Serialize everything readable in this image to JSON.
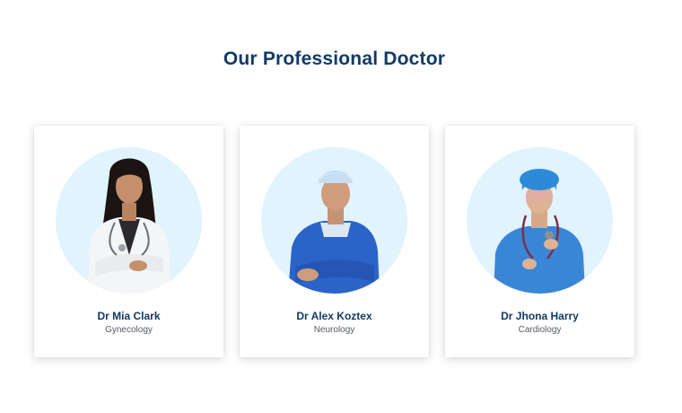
{
  "section": {
    "title": "Our Professional Doctor"
  },
  "doctors": [
    {
      "name": "Dr Mia Clark",
      "specialty": "Gynecology",
      "photo": "doctor-woman-white-coat"
    },
    {
      "name": "Dr Alex Koztex",
      "specialty": "Neurology",
      "photo": "doctor-man-surgical-scrubs"
    },
    {
      "name": "Dr Jhona Harry",
      "specialty": "Cardiology",
      "photo": "doctor-woman-surgical-gown"
    }
  ],
  "colors": {
    "title": "#123a63",
    "avatar_bg": "#e1f3fd",
    "specialty_text": "#555b63",
    "scrubs_blue": "#2b63c9"
  }
}
